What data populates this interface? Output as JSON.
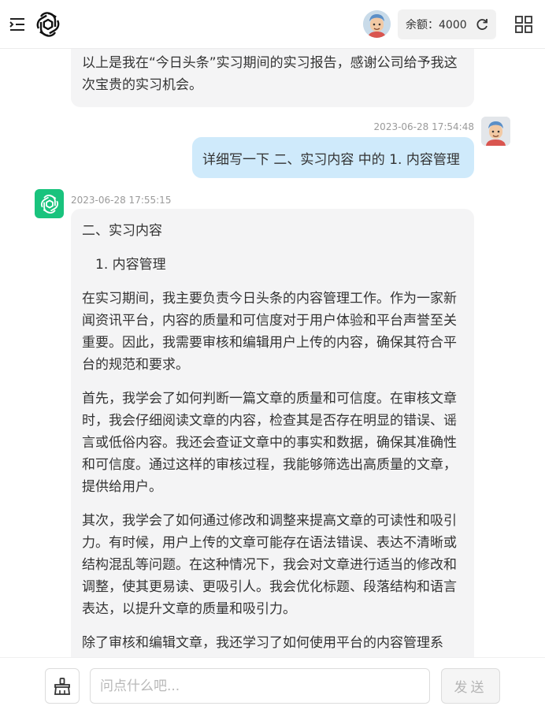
{
  "header": {
    "balance_label": "余额：4000",
    "icons": [
      "menu-icon",
      "openai-logo",
      "user-avatar",
      "refresh-icon",
      "grid-icon"
    ]
  },
  "messages": {
    "prev_bot_tail": "以上是我在“今日头条”实习期间的实习报告，感谢公司给予我这次宝贵的实习机会。",
    "user": {
      "timestamp": "2023-06-28 17:54:48",
      "text": "详细写一下 二、实习内容 中的 1. 内容管理"
    },
    "bot": {
      "timestamp": "2023-06-28 17:55:15",
      "heading": "二、实习内容",
      "subheading": "1. 内容管理",
      "paragraphs": [
        "在实习期间，我主要负责今日头条的内容管理工作。作为一家新闻资讯平台，内容的质量和可信度对于用户体验和平台声誉至关重要。因此，我需要审核和编辑用户上传的内容，确保其符合平台的规范和要求。",
        "首先，我学会了如何判断一篇文章的质量和可信度。在审核文章时，我会仔细阅读文章的内容，检查其是否存在明显的错误、谣言或低俗内容。我还会查证文章中的事实和数据，确保其准确性和可信度。通过这样的审核过程，我能够筛选出高质量的文章，提供给用户。",
        "其次，我学会了如何通过修改和调整来提高文章的可读性和吸引力。有时候，用户上传的文章可能存在语法错误、表达不清晰或结构混乱等问题。在这种情况下，我会对文章进行适当的修改和调整，使其更易读、更吸引人。我会优化标题、段落结构和语言表达，以提升文章的质量和吸引力。",
        "除了审核和编辑文章，我还学习了如何使用平台的内容管理系统，这个系统可以帮助我更高效地管理和处理大量的内容。我"
      ]
    }
  },
  "composer": {
    "placeholder": "问点什么吧...",
    "send_label": "发送",
    "colors": {
      "user_bubble": "#cfeafb",
      "bot_bubble": "#f4f4f5",
      "bot_avatar": "#19c37d"
    }
  }
}
